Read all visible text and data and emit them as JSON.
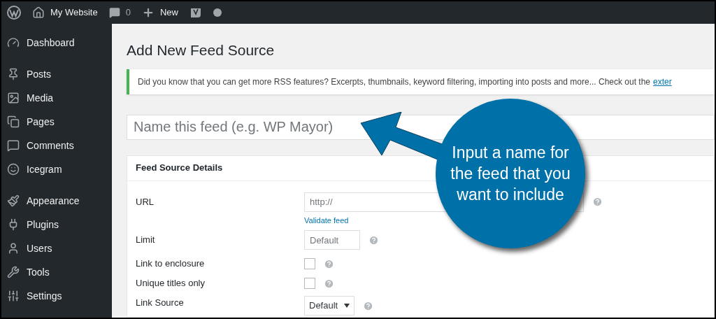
{
  "admin_bar": {
    "site_name": "My Website",
    "comments_count": "0",
    "new_label": "New"
  },
  "sidebar": {
    "groups": [
      [
        {
          "label": "Dashboard"
        }
      ],
      [
        {
          "label": "Posts"
        },
        {
          "label": "Media"
        },
        {
          "label": "Pages"
        },
        {
          "label": "Comments"
        },
        {
          "label": "Icegram"
        }
      ],
      [
        {
          "label": "Appearance"
        },
        {
          "label": "Plugins"
        },
        {
          "label": "Users"
        },
        {
          "label": "Tools"
        },
        {
          "label": "Settings"
        }
      ]
    ]
  },
  "page_title": "Add New Feed Source",
  "notice": {
    "text": "Did you know that you can get more RSS features? Excerpts, thumbnails, keyword filtering, importing into posts and more... Check out the",
    "link": "exter"
  },
  "name_field": {
    "placeholder": "Name this feed (e.g. WP Mayor)"
  },
  "panel": {
    "title": "Feed Source Details",
    "rows": [
      {
        "kind": "text",
        "label": "URL",
        "placeholder": "http://",
        "link": "Validate feed"
      },
      {
        "kind": "text",
        "label": "Limit",
        "placeholder": "Default"
      },
      {
        "kind": "checkbox",
        "label": "Link to enclosure",
        "checked": false
      },
      {
        "kind": "checkbox",
        "label": "Unique titles only",
        "checked": false
      },
      {
        "kind": "select",
        "label": "Link Source",
        "value": "Default"
      }
    ]
  },
  "callout": {
    "text": "Input a name for the feed that you want to include"
  }
}
